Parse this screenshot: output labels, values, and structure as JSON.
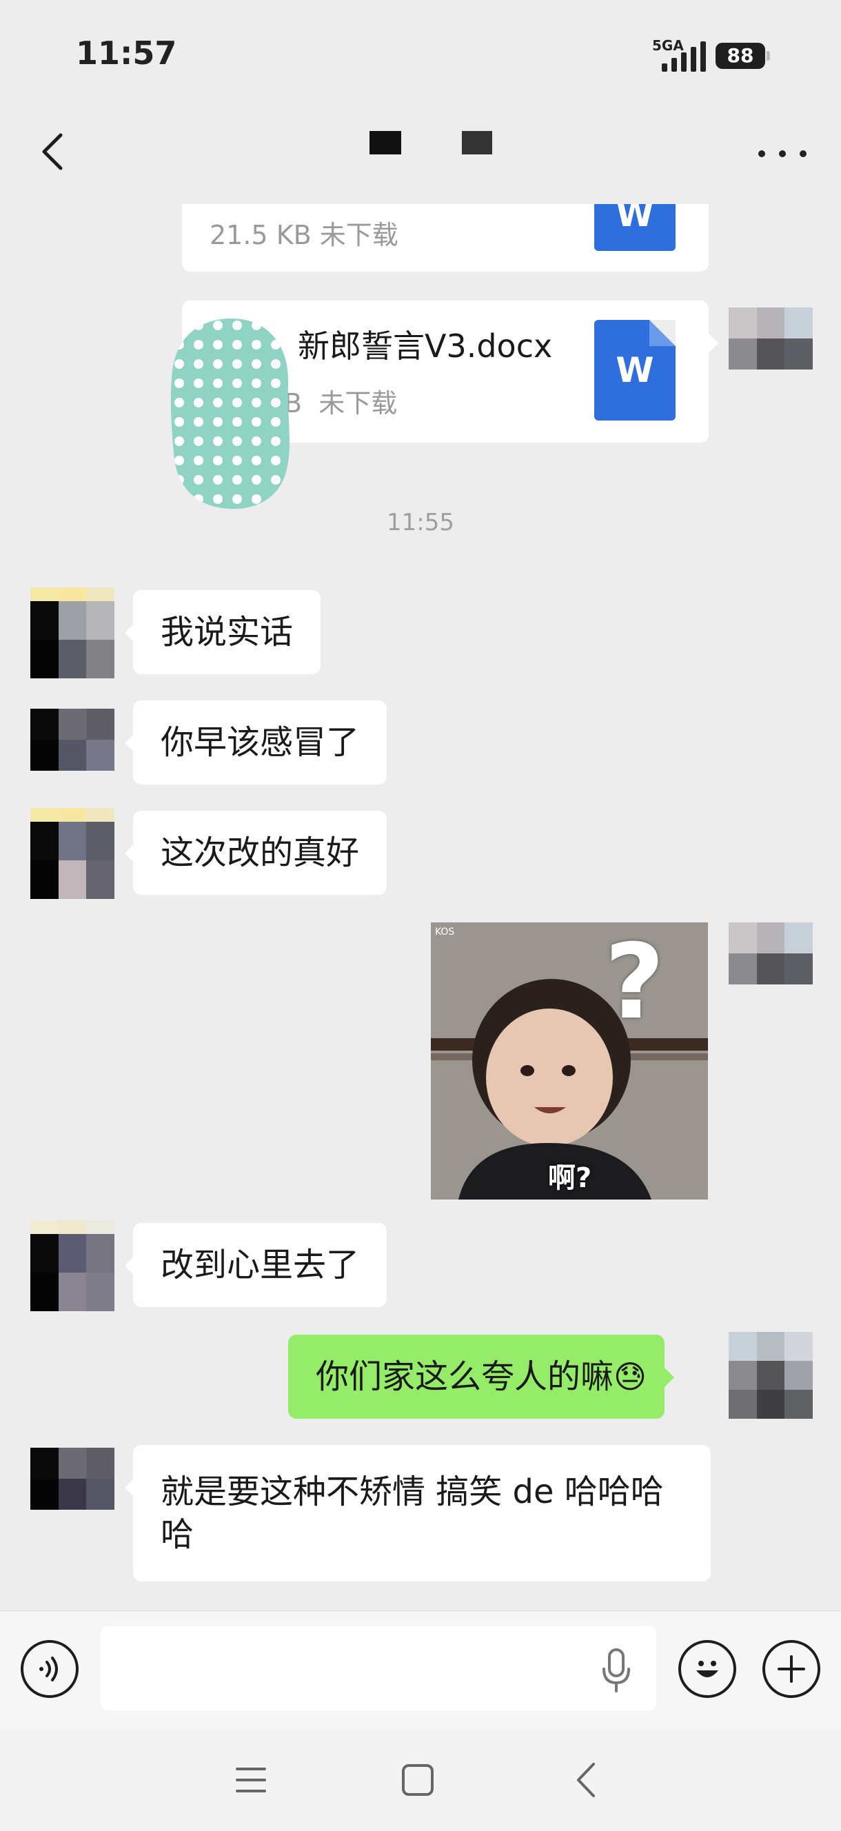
{
  "status_bar": {
    "time": "11:57",
    "network": "5GA",
    "battery": "88"
  },
  "header": {
    "title_redacted": true
  },
  "messages": {
    "file1": {
      "meta": "21.5 KB  未下载",
      "icon_letter": "W"
    },
    "file2": {
      "name_visible": "新郎誓言V3.docx",
      "size_fragment": "B",
      "status": "未下载",
      "icon_letter": "W"
    },
    "time_divider": "11:55",
    "msg1": "我说实话",
    "msg2": "你早该感冒了",
    "msg3": "这次改的真好",
    "sticker": {
      "caption": "啊?",
      "question_mark": "?",
      "corner_mark": "KOS"
    },
    "msg4": "改到心里去了",
    "msg5": "你们家这么夸人的嘛",
    "msg5_emoji": "😓",
    "msg6_line1": "就是要这种不矫情 搞笑 de 哈哈哈",
    "msg6_line2": "哈"
  },
  "colors": {
    "background": "#ededed",
    "self_bubble": "#95ec69",
    "other_bubble": "#ffffff",
    "word_icon": "#2f6fdd"
  },
  "icons": {
    "back": "chevron-left-icon",
    "more": "more-dots-icon",
    "voice": "voice-mode-icon",
    "mic": "microphone-icon",
    "emoji": "emoji-icon",
    "plus": "plus-icon",
    "nav_menu": "menu-icon",
    "nav_home": "home-icon",
    "nav_back": "back-icon"
  }
}
